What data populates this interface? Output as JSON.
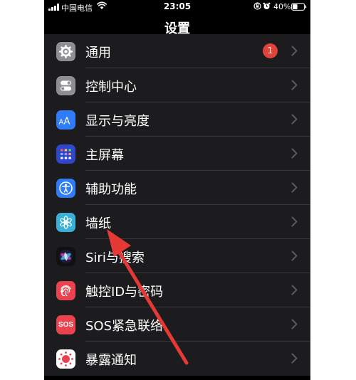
{
  "status_bar": {
    "carrier": "中国电信",
    "time": "23:05",
    "battery": "40%"
  },
  "nav": {
    "title": "设置"
  },
  "settings": {
    "items": [
      {
        "label": "通用",
        "icon": "gear-icon",
        "color": "#8e8e93",
        "badge": "1"
      },
      {
        "label": "控制中心",
        "icon": "toggles-icon",
        "color": "#8e8e93"
      },
      {
        "label": "显示与亮度",
        "icon": "text-size-icon",
        "color": "#2f7cf6"
      },
      {
        "label": "主屏幕",
        "icon": "home-grid-icon",
        "color": "#2f47c8"
      },
      {
        "label": "辅助功能",
        "icon": "accessibility-icon",
        "color": "#2f7cf6"
      },
      {
        "label": "墙纸",
        "icon": "flower-icon",
        "color": "#3ab0d8"
      },
      {
        "label": "Siri与搜索",
        "icon": "siri-icon",
        "color": "#111111"
      },
      {
        "label": "触控ID与密码",
        "icon": "fingerprint-icon",
        "color": "#e8434f"
      },
      {
        "label": "SOS紧急联络",
        "icon": "sos-icon",
        "color": "#e8434f",
        "icon_text": "SOS"
      },
      {
        "label": "暴露通知",
        "icon": "exposure-icon",
        "color": "#ffffff"
      }
    ]
  },
  "colors": {
    "background": "#000000",
    "cell": "#1c1c1e",
    "separator": "#38383a",
    "chevron": "#5a5a5e",
    "badge": "#e0433a",
    "annotation_arrow": "#e53935"
  }
}
